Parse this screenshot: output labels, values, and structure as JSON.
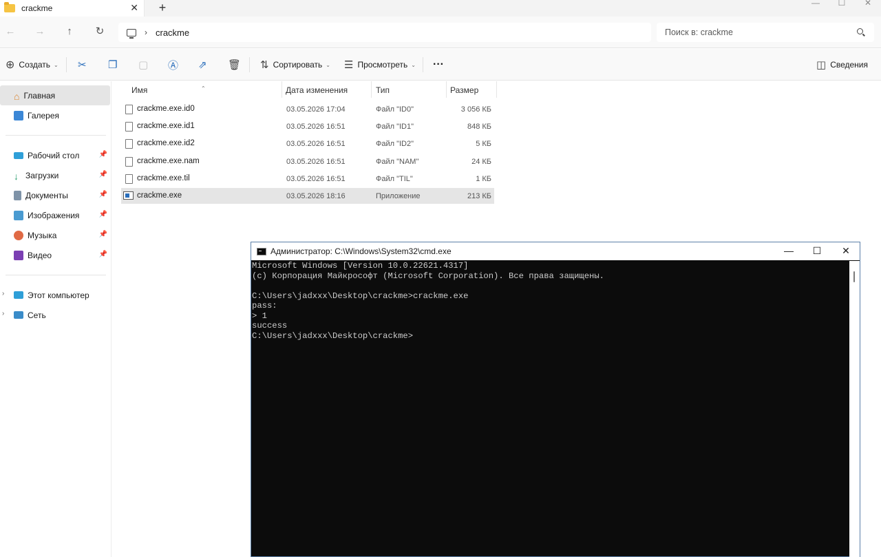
{
  "tab": {
    "title": "crackme",
    "close": "✕",
    "new_tab": "+"
  },
  "window_controls": {
    "minimize": "—",
    "maximize": "☐",
    "close": "✕"
  },
  "address": {
    "crumb": "crackme"
  },
  "search": {
    "placeholder": "Поиск в: crackme"
  },
  "toolbar": {
    "create": "Создать",
    "sort": "Сортировать",
    "view": "Просмотреть",
    "more": "···",
    "details": "Сведения"
  },
  "sidebar": {
    "home": "Главная",
    "gallery": "Галерея",
    "pinned": [
      {
        "label": "Рабочий стол"
      },
      {
        "label": "Загрузки"
      },
      {
        "label": "Документы"
      },
      {
        "label": "Изображения"
      },
      {
        "label": "Музыка"
      },
      {
        "label": "Видео"
      }
    ],
    "this_pc": "Этот компьютер",
    "network": "Сеть"
  },
  "filelist": {
    "headers": {
      "name": "Имя",
      "date": "Дата изменения",
      "type": "Тип",
      "size": "Размер"
    },
    "rows": [
      {
        "name": "crackme.exe.id0",
        "date": "03.05.2026 17:04",
        "type": "Файл \"ID0\"",
        "size": "3 056 КБ"
      },
      {
        "name": "crackme.exe.id1",
        "date": "03.05.2026 16:51",
        "type": "Файл \"ID1\"",
        "size": "848 КБ"
      },
      {
        "name": "crackme.exe.id2",
        "date": "03.05.2026 16:51",
        "type": "Файл \"ID2\"",
        "size": "5 КБ"
      },
      {
        "name": "crackme.exe.nam",
        "date": "03.05.2026 16:51",
        "type": "Файл \"NAM\"",
        "size": "24 КБ"
      },
      {
        "name": "crackme.exe.til",
        "date": "03.05.2026 16:51",
        "type": "Файл \"TIL\"",
        "size": "1 КБ"
      },
      {
        "name": "crackme.exe",
        "date": "03.05.2026 18:16",
        "type": "Приложение",
        "size": "213 КБ"
      }
    ]
  },
  "cmd": {
    "title": "Администратор: C:\\Windows\\System32\\cmd.exe",
    "lines": [
      "Microsoft Windows [Version 10.0.22621.4317]",
      "(c) Корпорация Майкрософт (Microsoft Corporation). Все права защищены.",
      "",
      "C:\\Users\\jadxxx\\Desktop\\crackme>crackme.exe",
      "pass:",
      "> 1",
      "success",
      "C:\\Users\\jadxxx\\Desktop\\crackme>"
    ]
  }
}
